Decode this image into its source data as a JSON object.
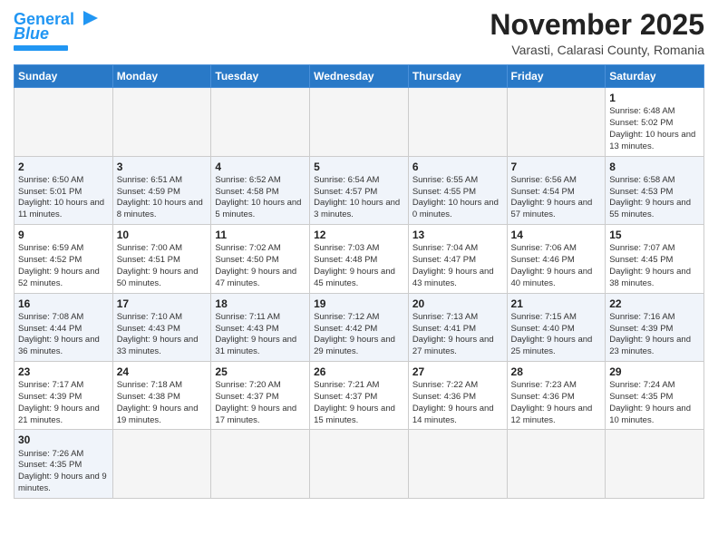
{
  "logo": {
    "text1": "General",
    "text2": "Blue"
  },
  "title": "November 2025",
  "subtitle": "Varasti, Calarasi County, Romania",
  "weekdays": [
    "Sunday",
    "Monday",
    "Tuesday",
    "Wednesday",
    "Thursday",
    "Friday",
    "Saturday"
  ],
  "weeks": [
    [
      {
        "day": "",
        "empty": true
      },
      {
        "day": "",
        "empty": true
      },
      {
        "day": "",
        "empty": true
      },
      {
        "day": "",
        "empty": true
      },
      {
        "day": "",
        "empty": true
      },
      {
        "day": "",
        "empty": true
      },
      {
        "day": "1",
        "sunrise": "6:48 AM",
        "sunset": "5:02 PM",
        "daylight": "10 hours and 13 minutes."
      }
    ],
    [
      {
        "day": "2",
        "sunrise": "6:50 AM",
        "sunset": "5:01 PM",
        "daylight": "10 hours and 11 minutes."
      },
      {
        "day": "3",
        "sunrise": "6:51 AM",
        "sunset": "4:59 PM",
        "daylight": "10 hours and 8 minutes."
      },
      {
        "day": "4",
        "sunrise": "6:52 AM",
        "sunset": "4:58 PM",
        "daylight": "10 hours and 5 minutes."
      },
      {
        "day": "5",
        "sunrise": "6:54 AM",
        "sunset": "4:57 PM",
        "daylight": "10 hours and 3 minutes."
      },
      {
        "day": "6",
        "sunrise": "6:55 AM",
        "sunset": "4:55 PM",
        "daylight": "10 hours and 0 minutes."
      },
      {
        "day": "7",
        "sunrise": "6:56 AM",
        "sunset": "4:54 PM",
        "daylight": "9 hours and 57 minutes."
      },
      {
        "day": "8",
        "sunrise": "6:58 AM",
        "sunset": "4:53 PM",
        "daylight": "9 hours and 55 minutes."
      }
    ],
    [
      {
        "day": "9",
        "sunrise": "6:59 AM",
        "sunset": "4:52 PM",
        "daylight": "9 hours and 52 minutes."
      },
      {
        "day": "10",
        "sunrise": "7:00 AM",
        "sunset": "4:51 PM",
        "daylight": "9 hours and 50 minutes."
      },
      {
        "day": "11",
        "sunrise": "7:02 AM",
        "sunset": "4:50 PM",
        "daylight": "9 hours and 47 minutes."
      },
      {
        "day": "12",
        "sunrise": "7:03 AM",
        "sunset": "4:48 PM",
        "daylight": "9 hours and 45 minutes."
      },
      {
        "day": "13",
        "sunrise": "7:04 AM",
        "sunset": "4:47 PM",
        "daylight": "9 hours and 43 minutes."
      },
      {
        "day": "14",
        "sunrise": "7:06 AM",
        "sunset": "4:46 PM",
        "daylight": "9 hours and 40 minutes."
      },
      {
        "day": "15",
        "sunrise": "7:07 AM",
        "sunset": "4:45 PM",
        "daylight": "9 hours and 38 minutes."
      }
    ],
    [
      {
        "day": "16",
        "sunrise": "7:08 AM",
        "sunset": "4:44 PM",
        "daylight": "9 hours and 36 minutes."
      },
      {
        "day": "17",
        "sunrise": "7:10 AM",
        "sunset": "4:43 PM",
        "daylight": "9 hours and 33 minutes."
      },
      {
        "day": "18",
        "sunrise": "7:11 AM",
        "sunset": "4:43 PM",
        "daylight": "9 hours and 31 minutes."
      },
      {
        "day": "19",
        "sunrise": "7:12 AM",
        "sunset": "4:42 PM",
        "daylight": "9 hours and 29 minutes."
      },
      {
        "day": "20",
        "sunrise": "7:13 AM",
        "sunset": "4:41 PM",
        "daylight": "9 hours and 27 minutes."
      },
      {
        "day": "21",
        "sunrise": "7:15 AM",
        "sunset": "4:40 PM",
        "daylight": "9 hours and 25 minutes."
      },
      {
        "day": "22",
        "sunrise": "7:16 AM",
        "sunset": "4:39 PM",
        "daylight": "9 hours and 23 minutes."
      }
    ],
    [
      {
        "day": "23",
        "sunrise": "7:17 AM",
        "sunset": "4:39 PM",
        "daylight": "9 hours and 21 minutes."
      },
      {
        "day": "24",
        "sunrise": "7:18 AM",
        "sunset": "4:38 PM",
        "daylight": "9 hours and 19 minutes."
      },
      {
        "day": "25",
        "sunrise": "7:20 AM",
        "sunset": "4:37 PM",
        "daylight": "9 hours and 17 minutes."
      },
      {
        "day": "26",
        "sunrise": "7:21 AM",
        "sunset": "4:37 PM",
        "daylight": "9 hours and 15 minutes."
      },
      {
        "day": "27",
        "sunrise": "7:22 AM",
        "sunset": "4:36 PM",
        "daylight": "9 hours and 14 minutes."
      },
      {
        "day": "28",
        "sunrise": "7:23 AM",
        "sunset": "4:36 PM",
        "daylight": "9 hours and 12 minutes."
      },
      {
        "day": "29",
        "sunrise": "7:24 AM",
        "sunset": "4:35 PM",
        "daylight": "9 hours and 10 minutes."
      }
    ],
    [
      {
        "day": "30",
        "sunrise": "7:26 AM",
        "sunset": "4:35 PM",
        "daylight": "9 hours and 9 minutes."
      },
      {
        "day": "",
        "empty": true
      },
      {
        "day": "",
        "empty": true
      },
      {
        "day": "",
        "empty": true
      },
      {
        "day": "",
        "empty": true
      },
      {
        "day": "",
        "empty": true
      },
      {
        "day": "",
        "empty": true
      }
    ]
  ]
}
